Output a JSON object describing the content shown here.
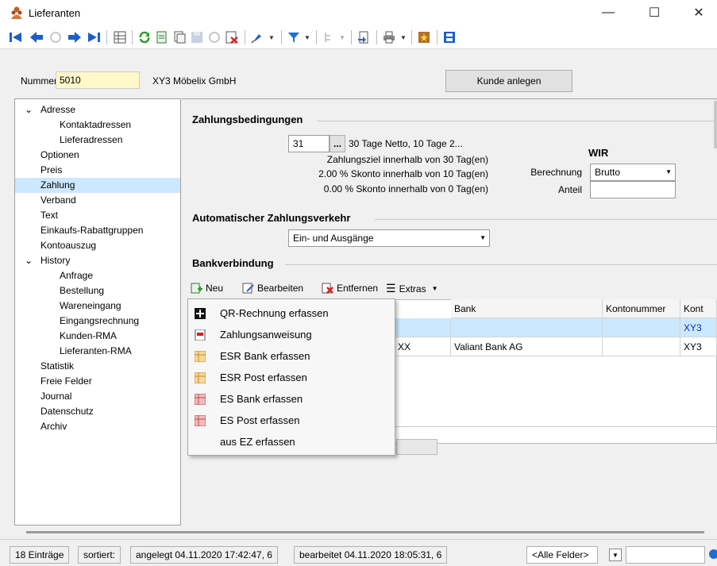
{
  "window": {
    "title": "Lieferanten"
  },
  "header": {
    "nummer_label": "Nummer",
    "nummer_value": "5010",
    "name": "XY3 Möbelix GmbH",
    "kunde_button": "Kunde anlegen"
  },
  "tree": [
    {
      "label": "Adresse",
      "level": 0,
      "expander": "v"
    },
    {
      "label": "Kontaktadressen",
      "level": 1
    },
    {
      "label": "Lieferadressen",
      "level": 1
    },
    {
      "label": "Optionen",
      "level": 0
    },
    {
      "label": "Preis",
      "level": 0
    },
    {
      "label": "Zahlung",
      "level": 0,
      "selected": true
    },
    {
      "label": "Verband",
      "level": 0
    },
    {
      "label": "Text",
      "level": 0
    },
    {
      "label": "Einkaufs-Rabattgruppen",
      "level": 0
    },
    {
      "label": "Kontoauszug",
      "level": 0
    },
    {
      "label": "History",
      "level": 0,
      "expander": "v"
    },
    {
      "label": "Anfrage",
      "level": 1
    },
    {
      "label": "Bestellung",
      "level": 1
    },
    {
      "label": "Wareneingang",
      "level": 1
    },
    {
      "label": "Eingangsrechnung",
      "level": 1
    },
    {
      "label": "Kunden-RMA",
      "level": 1
    },
    {
      "label": "Lieferanten-RMA",
      "level": 1
    },
    {
      "label": "Statistik",
      "level": 0
    },
    {
      "label": "Freie Felder",
      "level": 0
    },
    {
      "label": "Journal",
      "level": 0
    },
    {
      "label": "Datenschutz",
      "level": 0
    },
    {
      "label": "Archiv",
      "level": 0
    }
  ],
  "zahlung": {
    "title": "Zahlungsbedingungen",
    "code": "31",
    "ellipsis": "...",
    "description": "30 Tage Netto, 10 Tage 2...",
    "line1": "Zahlungsziel innerhalb von 30 Tag(en)",
    "line2": "2.00 % Skonto innerhalb von 10 Tag(en)",
    "line3": "0.00 % Skonto innerhalb von 0 Tag(en)"
  },
  "wir": {
    "title": "WIR",
    "berechnung_label": "Berechnung",
    "berechnung_value": "Brutto",
    "anteil_label": "Anteil",
    "anteil_value": ""
  },
  "auto": {
    "title": "Automatischer Zahlungsverkehr",
    "value": "Ein- und Ausgänge"
  },
  "bank": {
    "title": "Bankverbindung",
    "toolbar": {
      "neu": "Neu",
      "bearbeiten": "Bearbeiten",
      "entfernen": "Entfernen",
      "extras": "Extras"
    },
    "columns": [
      "Bank",
      "Kontonummer",
      "Kont"
    ],
    "rows": [
      {
        "partial": "",
        "bank": "",
        "kontonummer": "",
        "kont": "XY3"
      },
      {
        "partial": "XX",
        "bank": "Valiant Bank AG",
        "kontonummer": "",
        "kont": "XY3"
      }
    ]
  },
  "menu": {
    "items": [
      {
        "label": "QR-Rechnung erfassen",
        "icon": "qr-swiss-cross-icon"
      },
      {
        "label": "Zahlungsanweisung",
        "icon": "payment-order-icon"
      },
      {
        "label": "ESR Bank erfassen",
        "icon": "esr-form-icon"
      },
      {
        "label": "ESR Post erfassen",
        "icon": "esr-form-icon"
      },
      {
        "label": "ES Bank erfassen",
        "icon": "es-form-icon"
      },
      {
        "label": "ES Post erfassen",
        "icon": "es-form-icon"
      },
      {
        "label": "aus EZ erfassen",
        "icon": ""
      }
    ]
  },
  "status": {
    "count": "18 Einträge",
    "sorted": "sortiert:",
    "created": "angelegt 04.11.2020 17:42:47,  6",
    "edited": "bearbeitet 04.11.2020 18:05:31,  6",
    "filter": "<Alle Felder>"
  },
  "colors": {
    "selection": "#cce8ff",
    "link": "#0033cc",
    "accent": "#1e6fd0"
  }
}
